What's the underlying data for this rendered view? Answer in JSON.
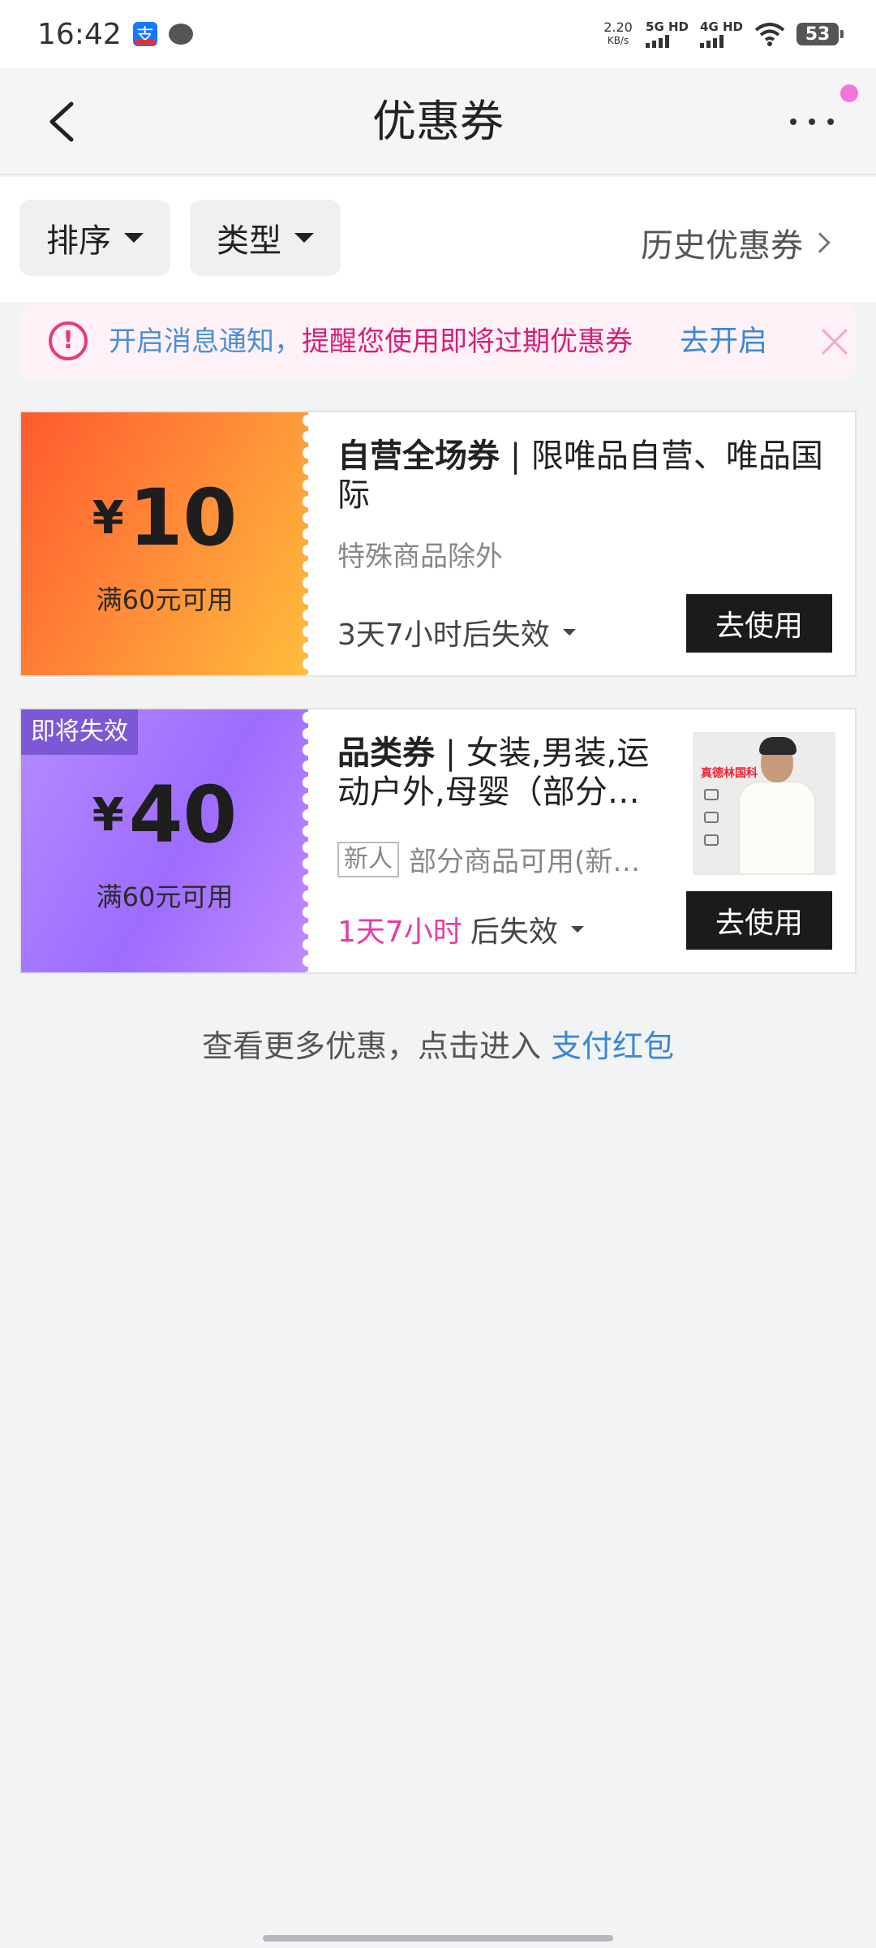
{
  "status_bar": {
    "time": "16:42",
    "app_badge_icon": "alipay-icon",
    "message_icon": "chat-bubble-icon",
    "speed_value": "2.20",
    "speed_unit": "KB/s",
    "net1": "5G HD",
    "net2": "4G HD",
    "battery": "53"
  },
  "nav": {
    "title": "优惠券",
    "back_icon": "back-arrow-icon",
    "more_icon": "more-dots-icon",
    "notification_dot_color": "#f675d8"
  },
  "filters": {
    "sort_label": "排序",
    "type_label": "类型",
    "history_label": "历史优惠券"
  },
  "notice": {
    "text_blue": "开启消息通知，",
    "text_pink": "提醒您使用即将过期优惠券",
    "action": "去开启",
    "colors": {
      "blue": "#4a8fd9",
      "pink": "#d81e79",
      "bg": "#fff1f8"
    }
  },
  "coupons": [
    {
      "currency": "¥",
      "amount": "10",
      "condition": "满60元可用",
      "title_bold": "自营全场券",
      "title_rest": " | 限唯品自营、唯品国际",
      "subtitle": "特殊商品除外",
      "expire": "3天7小时后失效",
      "button": "去使用",
      "gradient": [
        "#ff5a2e",
        "#ffbd3c"
      ]
    },
    {
      "badge": "即将失效",
      "currency": "¥",
      "amount": "40",
      "condition": "满60元可用",
      "title_bold": "品类券",
      "title_rest": " | 女装,男装,运动户外,母婴（部分…",
      "tag": "新人",
      "subtitle": "部分商品可用(新…",
      "expire_highlight": "1天7小时",
      "expire_rest": "后失效",
      "button": "去使用",
      "thumb_label": "真德林国科",
      "gradient": [
        "#b48cff",
        "#c08aff"
      ]
    }
  ],
  "footer": {
    "more_text": "查看更多优惠，点击进入",
    "more_link": "支付红包"
  }
}
